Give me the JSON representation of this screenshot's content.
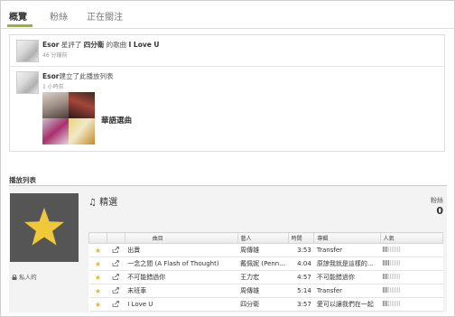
{
  "tabs": [
    {
      "label": "概覽",
      "active": true
    },
    {
      "label": "粉絲",
      "active": false
    },
    {
      "label": "正在關注",
      "active": false
    }
  ],
  "feed": [
    {
      "user": "Esor",
      "action": "星評了",
      "artist": "四分衛",
      "middle": "的歌曲",
      "title": "I Love U",
      "time": "46 分鐘前"
    },
    {
      "user": "Esor",
      "action": "建立了此播放列表",
      "time": "1 小時前",
      "playlist_name": "華語選曲"
    }
  ],
  "section": {
    "title": "播放列表"
  },
  "playlist": {
    "title": "♫ 精選",
    "followers_label": "粉絲",
    "followers_count": "0",
    "privacy": "私人的",
    "columns": [
      "曲目",
      "藝人",
      "時間",
      "專輯",
      "人氣"
    ],
    "tracks": [
      {
        "title": "出賣",
        "artist": "周傳雄",
        "time": "3:53",
        "album": "Transfer",
        "popularity": 0.3
      },
      {
        "title": "一念之間 (A Flash of Thought)",
        "artist": "戴佩妮 (Penn...",
        "time": "4:04",
        "album": "原諒我就是這樣的...",
        "popularity": 0.35
      },
      {
        "title": "不可能錯過你",
        "artist": "王力宏",
        "time": "4:57",
        "album": "不可能錯過你",
        "popularity": 0.3
      },
      {
        "title": "末班車",
        "artist": "周傳雄",
        "time": "5:14",
        "album": "Transfer",
        "popularity": 0.3
      },
      {
        "title": "I Love U",
        "artist": "四分衛",
        "time": "3:57",
        "album": "愛可以讓我們在一起",
        "popularity": 0.3
      }
    ]
  },
  "colors": {
    "accent": "#8cbc2a",
    "star": "#e8b22b",
    "star_box": "#555555"
  }
}
